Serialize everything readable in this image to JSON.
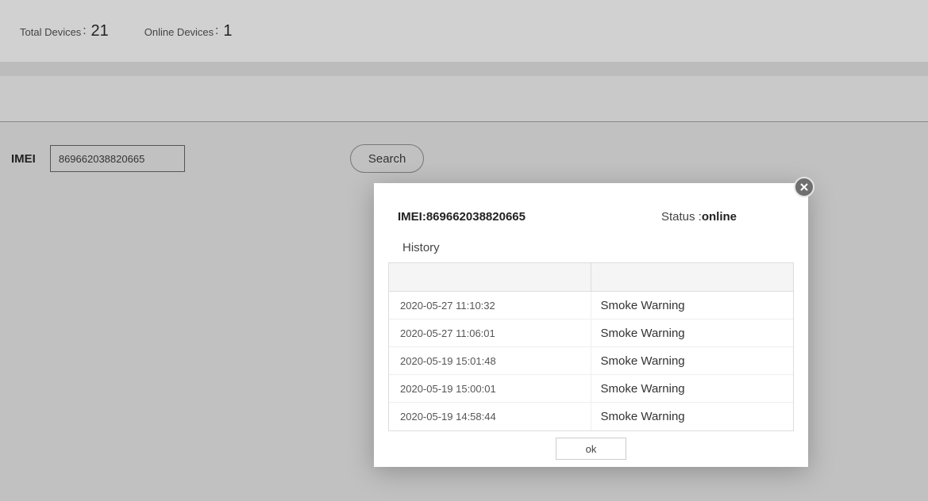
{
  "stats": {
    "total_label": "Total Devices",
    "total_value": "21",
    "online_label": "Online Devices",
    "online_value": "1"
  },
  "search": {
    "imei_label": "IMEI",
    "imei_value": "869662038820665",
    "button_label": "Search"
  },
  "modal": {
    "imei_label": "IMEI:",
    "imei_value": "869662038820665",
    "status_label": "Status",
    "status_separator": " :",
    "status_value": "online",
    "history_label": "History",
    "ok_label": "ok",
    "rows": [
      {
        "time": "2020-05-27 11:10:32",
        "event": "Smoke Warning"
      },
      {
        "time": "2020-05-27 11:06:01",
        "event": "Smoke Warning"
      },
      {
        "time": "2020-05-19 15:01:48",
        "event": "Smoke Warning"
      },
      {
        "time": "2020-05-19 15:00:01",
        "event": "Smoke Warning"
      },
      {
        "time": "2020-05-19 14:58:44",
        "event": "Smoke Warning"
      }
    ]
  }
}
